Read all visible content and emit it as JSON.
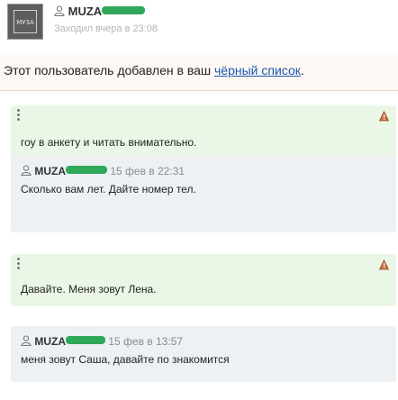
{
  "header": {
    "username": "MUZA",
    "last_seen": "Заходил вчера в 23:08",
    "avatar_text": "МУЗА"
  },
  "notice": {
    "text": "Этот пользователь добавлен в ваш ",
    "link": "чёрный список",
    "suffix": "."
  },
  "messages": [
    {
      "direction": "outgoing",
      "text": "гоу в анкету и читать внимательно."
    },
    {
      "direction": "incoming",
      "author": "MUZA",
      "date": "15 фев в 22:31",
      "text": "Сколько вам лет. Дайте номер тел."
    },
    {
      "direction": "outgoing",
      "text": "Давайте. Меня зовут Лена."
    },
    {
      "direction": "incoming",
      "author": "MUZA",
      "date": "15 фев в 13:57",
      "text": "меня зовут Саша, давайте по знакомится"
    }
  ],
  "colors": {
    "outgoing_bg": "#ebf7e6",
    "incoming_bg": "#edf1f4",
    "link": "#1a57b1",
    "redaction": "#2fa85a"
  }
}
